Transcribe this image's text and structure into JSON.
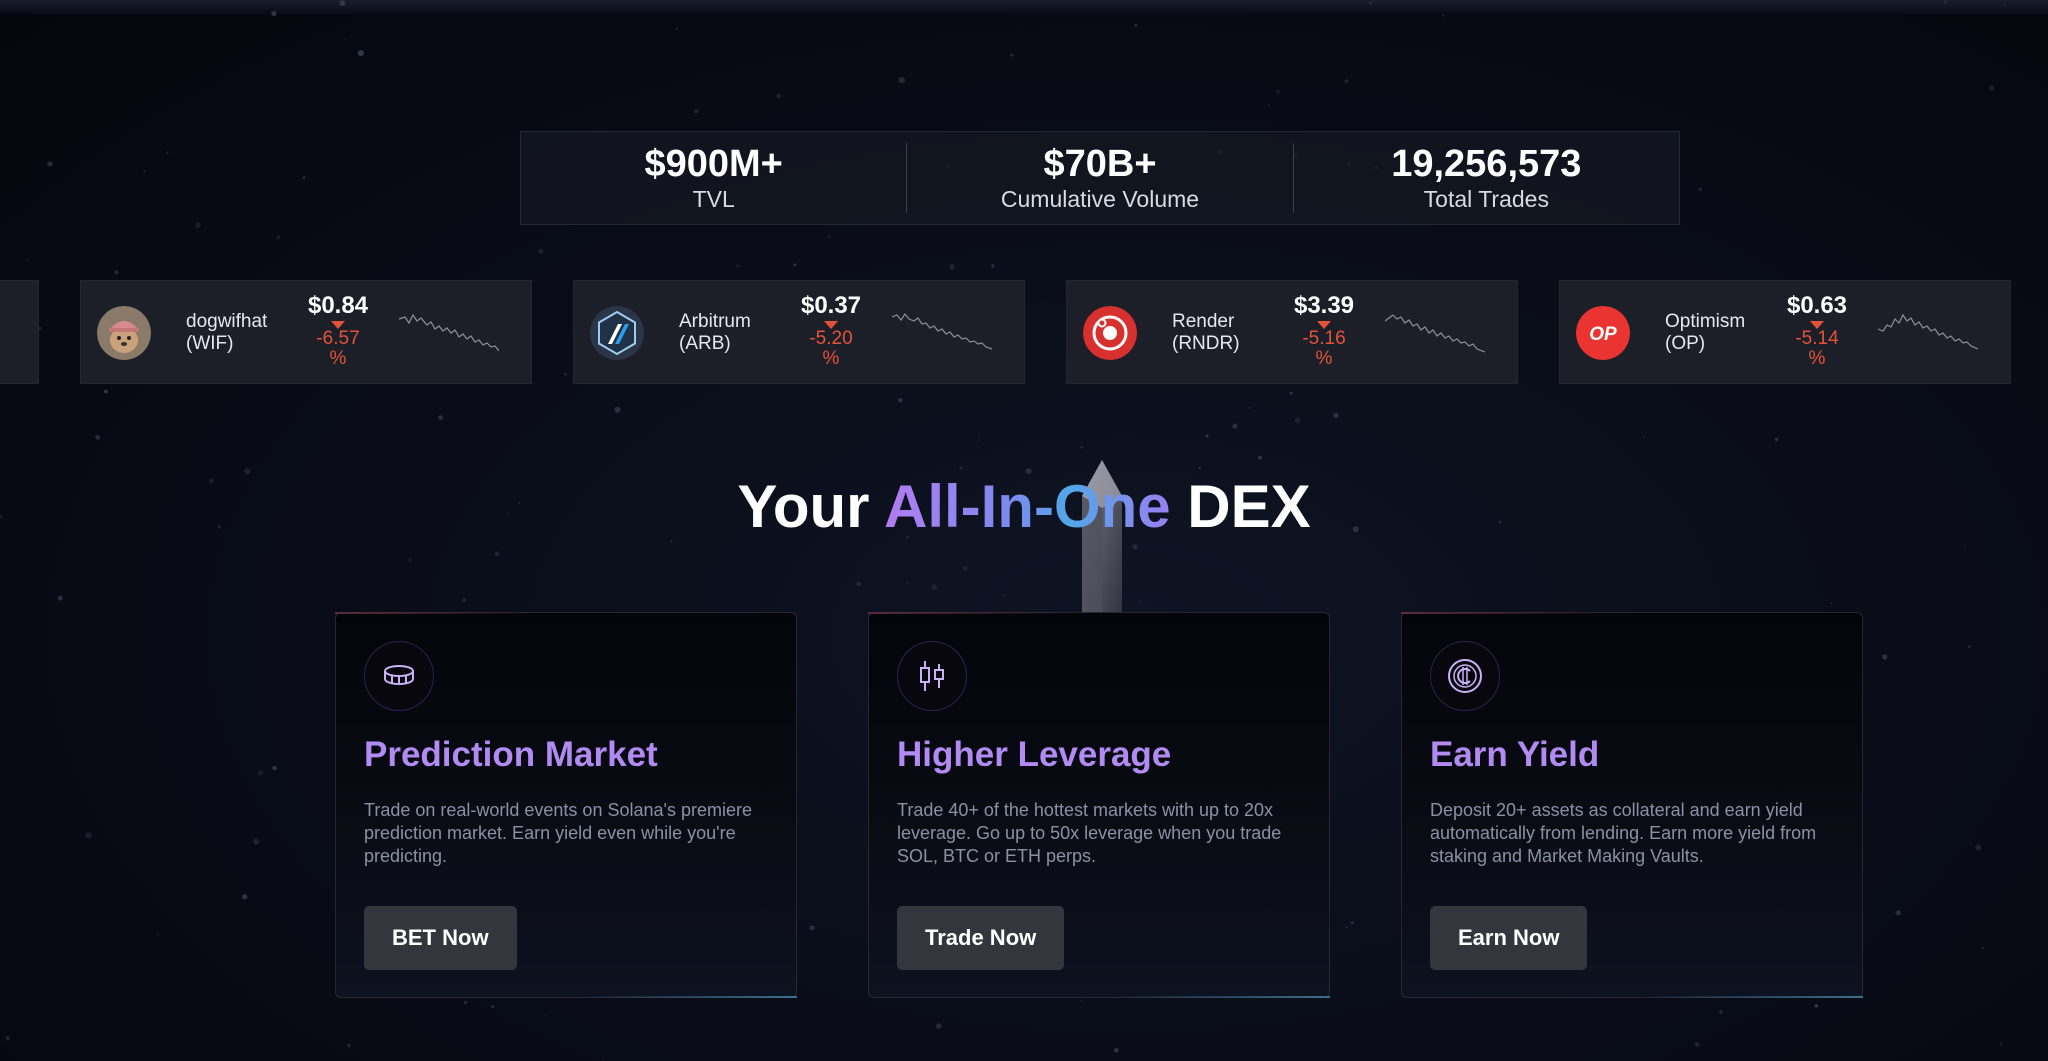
{
  "stats": [
    {
      "value": "$900M+",
      "label": "TVL"
    },
    {
      "value": "$70B+",
      "label": "Cumulative Volume"
    },
    {
      "value": "19,256,573",
      "label": "Total Trades"
    }
  ],
  "tokens": [
    {
      "name": "dogwifhat",
      "symbol": "(WIF)",
      "price": "$0.84",
      "change": "-6.57",
      "pct": "%",
      "icon": "dogwifhat-icon",
      "trend": "down"
    },
    {
      "name": "Arbitrum",
      "symbol": "(ARB)",
      "price": "$0.37",
      "change": "-5.20",
      "pct": "%",
      "icon": "arbitrum-icon",
      "trend": "down"
    },
    {
      "name": "Render",
      "symbol": "(RNDR)",
      "price": "$3.39",
      "change": "-5.16",
      "pct": "%",
      "icon": "render-icon",
      "trend": "down"
    },
    {
      "name": "Optimism",
      "symbol": "(OP)",
      "price": "$0.63",
      "change": "-5.14",
      "pct": "%",
      "icon": "optimism-icon",
      "icon_text": "OP",
      "trend": "down"
    }
  ],
  "headline": {
    "part1": "Your ",
    "highlight": "All-In-One",
    "part2": " DEX"
  },
  "features": [
    {
      "title": "Prediction Market",
      "description": "Trade on real-world events on Solana's premiere prediction market. Earn yield even while you're predicting.",
      "button": "BET Now",
      "icon": "coin-stack-icon"
    },
    {
      "title": "Higher Leverage",
      "description": "Trade 40+ of the hottest markets with up to 20x leverage. Go up to 50x leverage when you trade SOL, BTC or ETH perps.",
      "button": "Trade Now",
      "icon": "candlestick-icon"
    },
    {
      "title": "Earn Yield",
      "description": "Deposit 20+ assets as collateral and earn yield automatically from lending. Earn more yield from staking and Market Making Vaults.",
      "button": "Earn Now",
      "icon": "coin-currency-icon"
    }
  ],
  "colors": {
    "accent_purple": "#b28bf2",
    "negative": "#e2533a",
    "card_bg": "#1c1f27"
  }
}
